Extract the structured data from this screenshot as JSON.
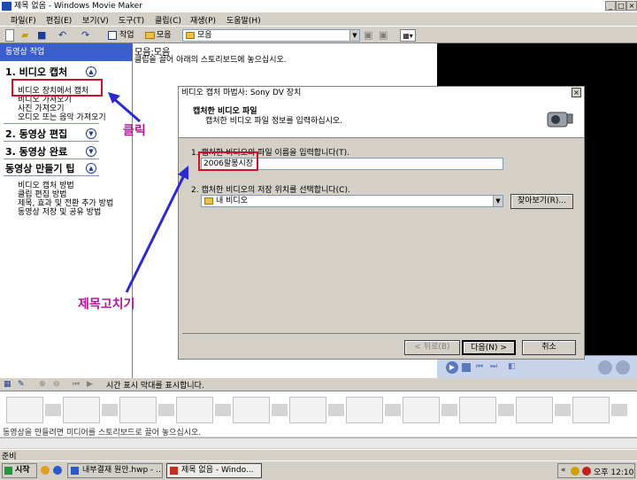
{
  "window": {
    "title": "제목 없음 - Windows Movie Maker"
  },
  "menu": [
    "파일(F)",
    "편집(E)",
    "보기(V)",
    "도구(T)",
    "클립(C)",
    "재생(P)",
    "도움말(H)"
  ],
  "toolbar": {
    "tasks_label": "작업",
    "collections_label": "모음",
    "collection_combo": "모음"
  },
  "taskpane": {
    "header": "동영상 작업",
    "sections": [
      {
        "title": "1. 비디오 캡처",
        "links": [
          "비디오 장치에서 캡처",
          "비디오 가져오기",
          "사진 가져오기",
          "오디오 또는 음악 가져오기"
        ]
      },
      {
        "title": "2. 동영상 편집",
        "links": []
      },
      {
        "title": "3. 동영상 완료",
        "links": []
      },
      {
        "title": "동영상 만들기 팁",
        "links": [
          "비디오 캡처 방법",
          "클립 편집 방법",
          "제목, 효과 및 전환 추가 방법",
          "동영상 저장 및 공유 방법"
        ]
      }
    ]
  },
  "collection": {
    "title": "모음:모음",
    "hint": "클립을 끌어 아래의 스토리보드에 놓으십시오."
  },
  "dialog": {
    "title": "비디오 캡처 마법사: Sony DV 장치",
    "head_title": "캡처한 비디오 파일",
    "head_sub": "캡처한 비디오 파일 정보를 입력하십시오.",
    "q1": "1. 캡처한 비디오의 파일 이름을 입력합니다(T).",
    "filename": "2006팔봉시장",
    "q2": "2. 캡처한 비디오의 저장 위치를 선택합니다(C).",
    "location": "내 비디오",
    "browse": "찾아보기(R)...",
    "back": "< 뒤로(B)",
    "next": "다음(N) >",
    "cancel": "취소"
  },
  "annotations": {
    "click": "클릭",
    "rename": "제목고치기"
  },
  "storyboard": {
    "timeline_label": "시간 표시 막대를 표시합니다.",
    "hint": "동영상을 만들려면 미디어를 스토리보드로 끌어 놓으십시오."
  },
  "status": "준비",
  "taskbar": {
    "start": "시작",
    "tasks": [
      "내부결재 원안.hwp - ...",
      "제목 없음 - Windo..."
    ],
    "clock": "오후 12:10"
  },
  "colors": {
    "task_header": "#3a5ecb",
    "annotation": "#b0189a",
    "highlight": "#d0102a",
    "arrow": "#2a2ad0"
  }
}
